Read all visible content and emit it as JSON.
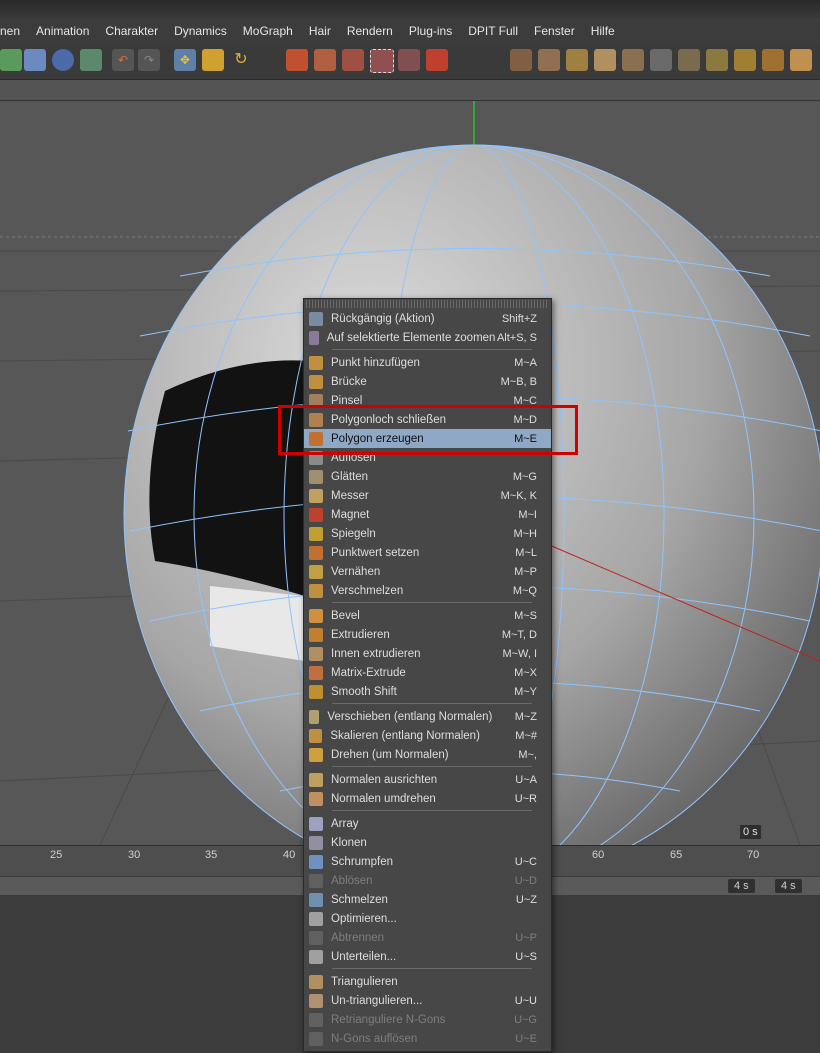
{
  "menubar": {
    "items": [
      "nen",
      "Animation",
      "Charakter",
      "Dynamics",
      "MoGraph",
      "Hair",
      "Rendern",
      "Plug-ins",
      "DPIT Full",
      "Fenster",
      "Hilfe"
    ]
  },
  "viewport": {
    "frame_label": "0 s"
  },
  "timeline": {
    "ticks": [
      "25",
      "30",
      "35",
      "40",
      "60",
      "65",
      "70"
    ],
    "end_field_1": "4 s",
    "end_field_2": "4 s"
  },
  "context_menu": {
    "items": [
      {
        "label": "Rückgängig (Aktion)",
        "shortcut": "Shift+Z",
        "icon": "undo-icon"
      },
      {
        "label": "Auf selektierte Elemente zoomen",
        "shortcut": "Alt+S, S",
        "icon": "zoom-icon"
      },
      {
        "label": "Punkt hinzufügen",
        "shortcut": "M~A",
        "icon": "add-point-icon"
      },
      {
        "label": "Brücke",
        "shortcut": "M~B, B",
        "icon": "bridge-icon"
      },
      {
        "label": "Pinsel",
        "shortcut": "M~C",
        "icon": "brush-icon"
      },
      {
        "label": "Polygonloch schließen",
        "shortcut": "M~D",
        "icon": "close-hole-icon"
      },
      {
        "label": "Polygon erzeugen",
        "shortcut": "M~E",
        "icon": "create-polygon-icon"
      },
      {
        "label": "Auflösen",
        "shortcut": "",
        "icon": "dissolve-icon"
      },
      {
        "label": "Glätten",
        "shortcut": "M~G",
        "icon": "smooth-icon"
      },
      {
        "label": "Messer",
        "shortcut": "M~K, K",
        "icon": "knife-icon"
      },
      {
        "label": "Magnet",
        "shortcut": "M~I",
        "icon": "magnet-icon"
      },
      {
        "label": "Spiegeln",
        "shortcut": "M~H",
        "icon": "mirror-icon"
      },
      {
        "label": "Punktwert setzen",
        "shortcut": "M~L",
        "icon": "set-point-icon"
      },
      {
        "label": "Vernähen",
        "shortcut": "M~P",
        "icon": "stitch-icon"
      },
      {
        "label": "Verschmelzen",
        "shortcut": "M~Q",
        "icon": "weld-icon"
      },
      {
        "label": "Bevel",
        "shortcut": "M~S",
        "icon": "bevel-icon"
      },
      {
        "label": "Extrudieren",
        "shortcut": "M~T, D",
        "icon": "extrude-icon"
      },
      {
        "label": "Innen extrudieren",
        "shortcut": "M~W, I",
        "icon": "extrude-inner-icon"
      },
      {
        "label": "Matrix-Extrude",
        "shortcut": "M~X",
        "icon": "matrix-extrude-icon"
      },
      {
        "label": "Smooth Shift",
        "shortcut": "M~Y",
        "icon": "smooth-shift-icon"
      },
      {
        "label": "Verschieben (entlang Normalen)",
        "shortcut": "M~Z",
        "icon": "normal-move-icon"
      },
      {
        "label": "Skalieren (entlang Normalen)",
        "shortcut": "M~#",
        "icon": "normal-scale-icon"
      },
      {
        "label": "Drehen (um Normalen)",
        "shortcut": "M~,",
        "icon": "normal-rotate-icon"
      },
      {
        "label": "Normalen ausrichten",
        "shortcut": "U~A",
        "icon": "align-normals-icon"
      },
      {
        "label": "Normalen umdrehen",
        "shortcut": "U~R",
        "icon": "reverse-normals-icon"
      },
      {
        "label": "Array",
        "shortcut": "",
        "icon": "array-icon"
      },
      {
        "label": "Klonen",
        "shortcut": "",
        "icon": "clone-icon"
      },
      {
        "label": "Schrumpfen",
        "shortcut": "U~C",
        "icon": "collapse-icon"
      },
      {
        "label": "Ablösen",
        "shortcut": "U~D",
        "icon": "disconnect-icon"
      },
      {
        "label": "Schmelzen",
        "shortcut": "U~Z",
        "icon": "melt-icon"
      },
      {
        "label": "Optimieren...",
        "shortcut": "",
        "icon": "optimize-icon"
      },
      {
        "label": "Abtrennen",
        "shortcut": "U~P",
        "icon": "split-icon"
      },
      {
        "label": "Unterteilen...",
        "shortcut": "U~S",
        "icon": "subdivide-icon"
      },
      {
        "label": "Triangulieren",
        "shortcut": "",
        "icon": "triangulate-icon"
      },
      {
        "label": "Un-triangulieren...",
        "shortcut": "U~U",
        "icon": "untriangulate-icon"
      },
      {
        "label": "Retrianguliere N-Gons",
        "shortcut": "U~G",
        "icon": "retriangulate-icon"
      },
      {
        "label": "N-Gons auflösen",
        "shortcut": "U~E",
        "icon": "remove-ngons-icon"
      }
    ]
  }
}
